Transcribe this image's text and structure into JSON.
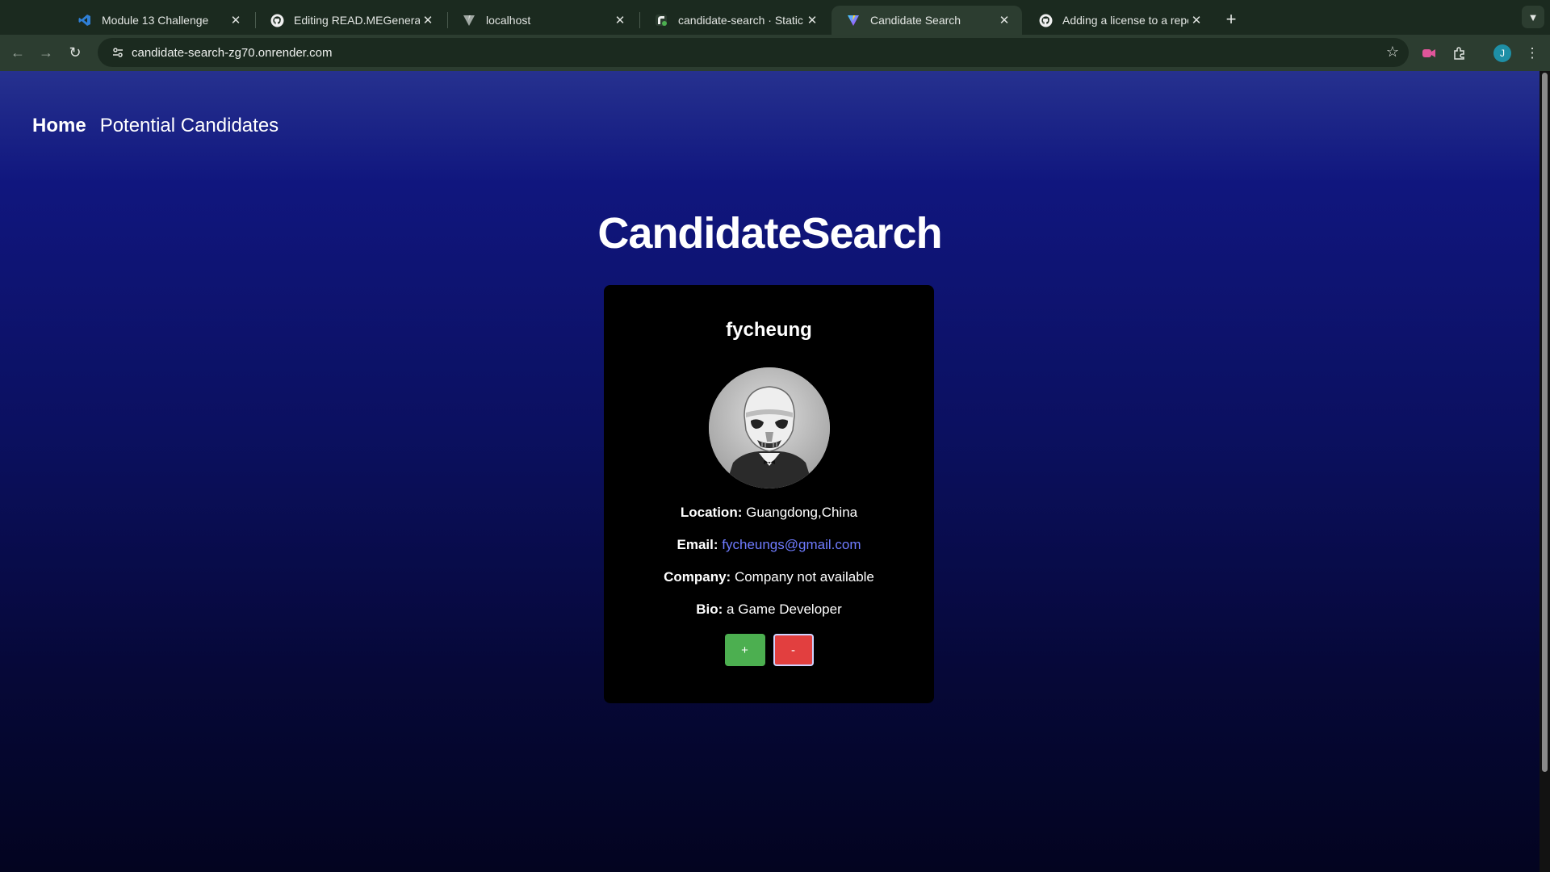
{
  "browser": {
    "tabs": [
      {
        "title": "Module 13 Challenge",
        "icon": "vscode-icon",
        "active": false
      },
      {
        "title": "Editing READ.MEGenerator/R",
        "icon": "github-icon",
        "active": false
      },
      {
        "title": "localhost",
        "icon": "vite-icon",
        "active": false
      },
      {
        "title": "candidate-search · Static Si",
        "icon": "render-icon",
        "active": false
      },
      {
        "title": "Candidate Search",
        "icon": "vite-icon",
        "active": true
      },
      {
        "title": "Adding a license to a reposito",
        "icon": "github-icon",
        "active": false
      }
    ],
    "new_tab_label": "+",
    "url": "candidate-search-zg70.onrender.com",
    "profile_initial": "J"
  },
  "nav": {
    "home_label": "Home",
    "candidates_label": "Potential Candidates"
  },
  "page": {
    "title": "CandidateSearch"
  },
  "candidate": {
    "login": "fycheung",
    "location_label": "Location:",
    "location": "Guangdong,China",
    "email_label": "Email:",
    "email": "fycheungs@gmail.com",
    "company_label": "Company:",
    "company": "Company not available",
    "bio_label": "Bio:",
    "bio": "a Game Developer",
    "add_label": "+",
    "reject_label": "-"
  },
  "colors": {
    "add_button": "#4caf50",
    "reject_button": "#e23f3f",
    "email_link": "#6f7cff",
    "card_bg": "#000000"
  }
}
